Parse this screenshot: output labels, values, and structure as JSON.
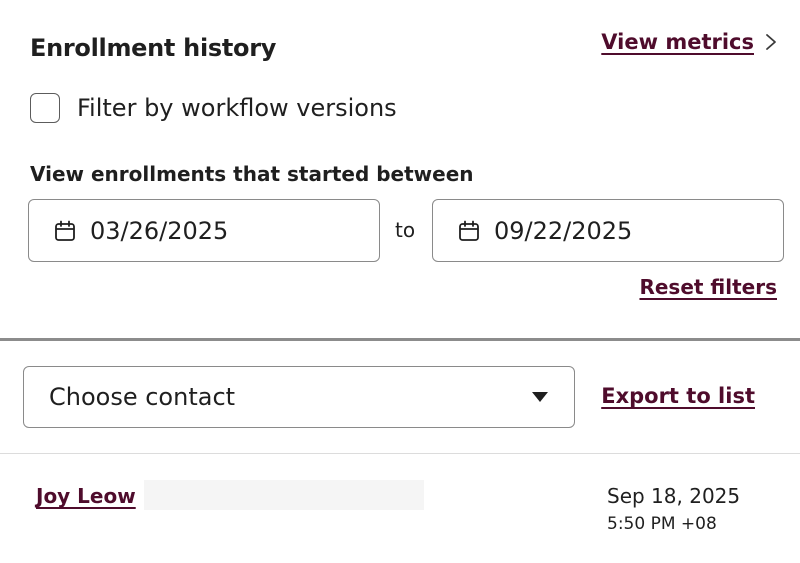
{
  "header": {
    "title": "Enrollment history",
    "metrics_link": "View metrics"
  },
  "filter": {
    "checkbox_label": "Filter by workflow versions",
    "checked": false
  },
  "date_range": {
    "label": "View enrollments that started between",
    "start": "03/26/2025",
    "separator": "to",
    "end": "09/22/2025",
    "reset_label": "Reset filters"
  },
  "contact_picker": {
    "selected": "Choose contact",
    "export_label": "Export to list"
  },
  "enrollments": [
    {
      "name": "Joy Leow",
      "date": "Sep 18, 2025",
      "time": "5:50 PM +08"
    }
  ],
  "colors": {
    "link": "#4f0c2c",
    "text": "#1f1f1f",
    "border": "#8a8a8a"
  },
  "icons": {
    "metrics_chevron": "chevron-right-icon",
    "date": "calendar-icon",
    "select": "caret-down-icon"
  }
}
